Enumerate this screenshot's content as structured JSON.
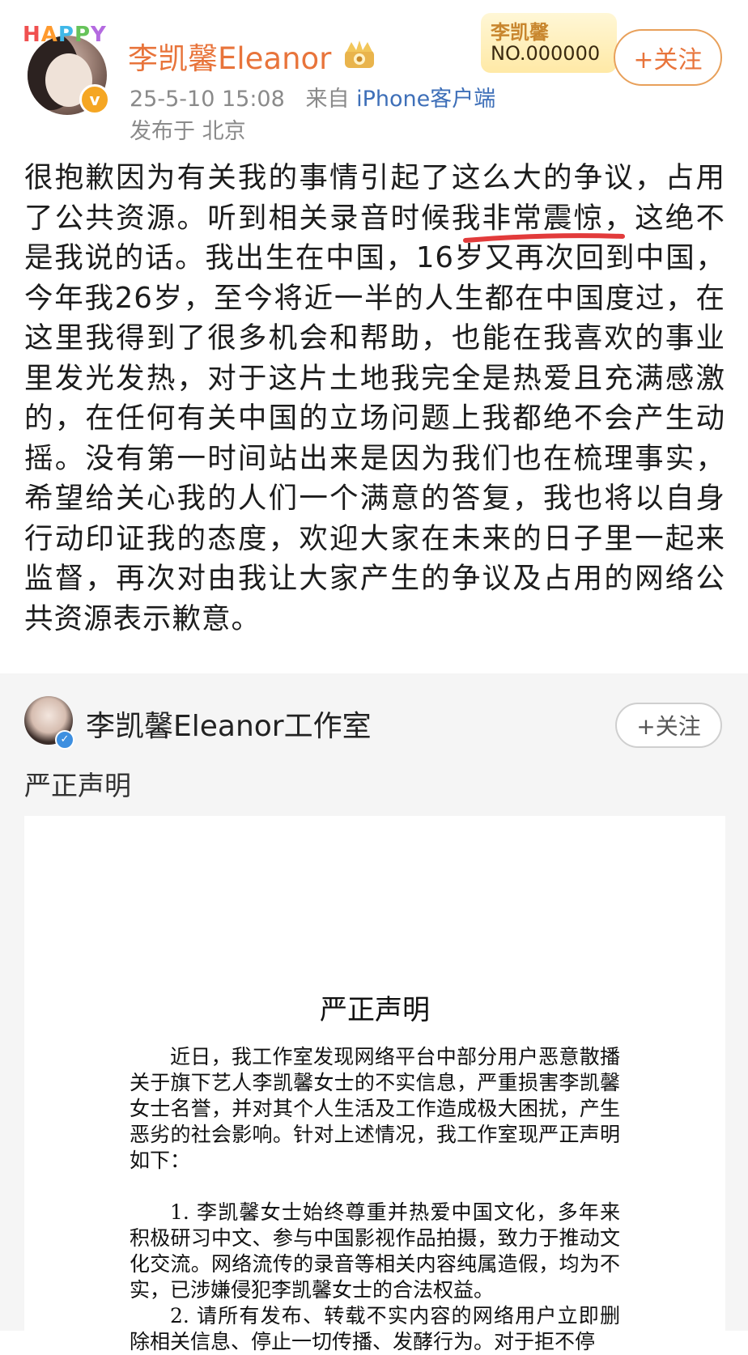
{
  "post1": {
    "avatar_tag": "HAPPY",
    "username": "李凯馨Eleanor",
    "verified_badge": "v",
    "timestamp": "25-5-10 15:08",
    "source_prefix": "来自",
    "source_client": "iPhone客户端",
    "location": "发布于 北京",
    "fan_badge_name": "李凯馨",
    "fan_badge_number": "NO.000000",
    "follow_label": "+关注",
    "body": "很抱歉因为有关我的事情引起了这么大的争议，占用了公共资源。听到相关录音时候我非常震惊，这绝不是我说的话。我出生在中国，16岁又再次回到中国，今年我26岁，至今将近一半的人生都在中国度过，在这里我得到了很多机会和帮助，也能在我喜欢的事业里发光发热，对于这片土地我完全是热爱且充满感激的，在任何有关中国的立场问题上我都绝不会产生动摇。没有第一时间站出来是因为我们也在梳理事实，希望给关心我的人们一个满意的答复，我也将以自身行动印证我的态度，欢迎大家在未来的日子里一起来监督，再次对由我让大家产生的争议及占用的网络公共资源表示歉意。"
  },
  "post2": {
    "username": "李凯馨Eleanor工作室",
    "follow_label": "+关注",
    "title": "严正声明",
    "document": {
      "title": "严正声明",
      "intro": "近日，我工作室发现网络平台中部分用户恶意散播关于旗下艺人李凯馨女士的不实信息，严重损害李凯馨女士名誉，并对其个人生活及工作造成极大困扰，产生恶劣的社会影响。针对上述情况，我工作室现严正声明如下：",
      "item1": "1. 李凯馨女士始终尊重并热爱中国文化，多年来积极研习中文、参与中国影视作品拍摄，致力于推动文化交流。网络流传的录音等相关内容纯属造假，均为不实，已涉嫌侵犯李凯馨女士的合法权益。",
      "item2": "2. 请所有发布、转载不实内容的网络用户立即删除相关信息、停止一切传播、发酵行为。对于拒不停"
    }
  },
  "colors": {
    "username_orange": "#e8743b",
    "meta_gray": "#8a8a8a",
    "client_blue": "#3e6fb8",
    "underline_red": "#e23b3b"
  }
}
